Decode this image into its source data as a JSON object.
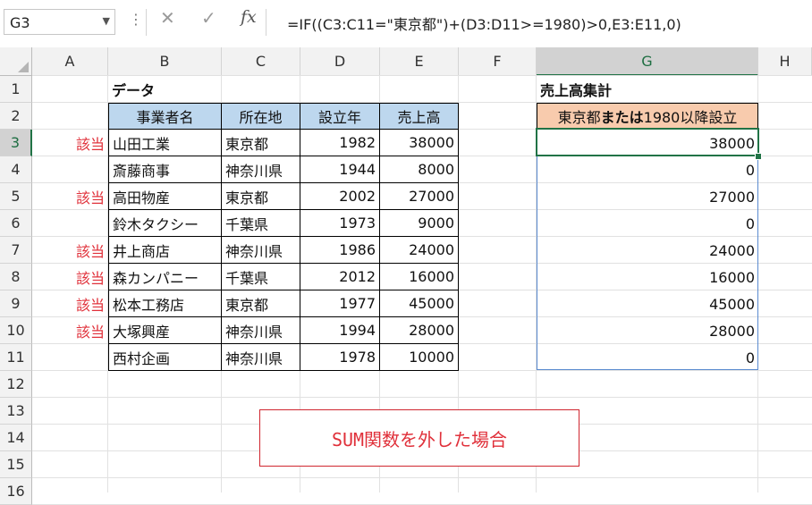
{
  "formula_bar": {
    "name_box": "G3",
    "formula": "=IF((C3:C11=\"東京都\")+(D3:D11>=1980)>0,E3:E11,0)",
    "icons": [
      "chevron-down-icon",
      "more-dots-icon",
      "cancel-icon",
      "enter-check-icon",
      "function-icon"
    ],
    "fx_label": "fx"
  },
  "columns": [
    "A",
    "B",
    "C",
    "D",
    "E",
    "F",
    "G",
    "H"
  ],
  "rows": [
    "1",
    "2",
    "3",
    "4",
    "5",
    "6",
    "7",
    "8",
    "9",
    "10",
    "11",
    "12",
    "13",
    "14",
    "15",
    "16"
  ],
  "selection": {
    "active_column": "G",
    "active_row": "3"
  },
  "sheet": {
    "data_title": "データ",
    "table_headers": [
      "事業者名",
      "所在地",
      "設立年",
      "売上高"
    ],
    "table_rows": [
      {
        "flag": "該当",
        "name": "山田工業",
        "location": "東京都",
        "year": "1982",
        "sales": "38000"
      },
      {
        "flag": "",
        "name": "斎藤商事",
        "location": "神奈川県",
        "year": "1944",
        "sales": "8000"
      },
      {
        "flag": "該当",
        "name": "高田物産",
        "location": "東京都",
        "year": "2002",
        "sales": "27000"
      },
      {
        "flag": "",
        "name": "鈴木タクシー",
        "location": "千葉県",
        "year": "1973",
        "sales": "9000"
      },
      {
        "flag": "該当",
        "name": "井上商店",
        "location": "神奈川県",
        "year": "1986",
        "sales": "24000"
      },
      {
        "flag": "該当",
        "name": "森カンパニー",
        "location": "千葉県",
        "year": "2012",
        "sales": "16000"
      },
      {
        "flag": "該当",
        "name": "松本工務店",
        "location": "東京都",
        "year": "1977",
        "sales": "45000"
      },
      {
        "flag": "該当",
        "name": "大塚興産",
        "location": "神奈川県",
        "year": "1994",
        "sales": "28000"
      },
      {
        "flag": "",
        "name": "西村企画",
        "location": "神奈川県",
        "year": "1978",
        "sales": "10000"
      }
    ],
    "summary_title": "売上高集計",
    "summary_header": {
      "part1": "東京都",
      "part2": "または",
      "part3": "1980以降設立"
    },
    "summary_values": [
      "38000",
      "0",
      "27000",
      "0",
      "24000",
      "16000",
      "45000",
      "28000",
      "0"
    ],
    "note": "SUM関数を外した場合"
  },
  "colors": {
    "accent_green": "#217346",
    "header_blue": "#bdd7ee",
    "header_orange": "#f8cbad",
    "flag_red": "#e0303a",
    "selection_blue": "#5b8bd0"
  }
}
